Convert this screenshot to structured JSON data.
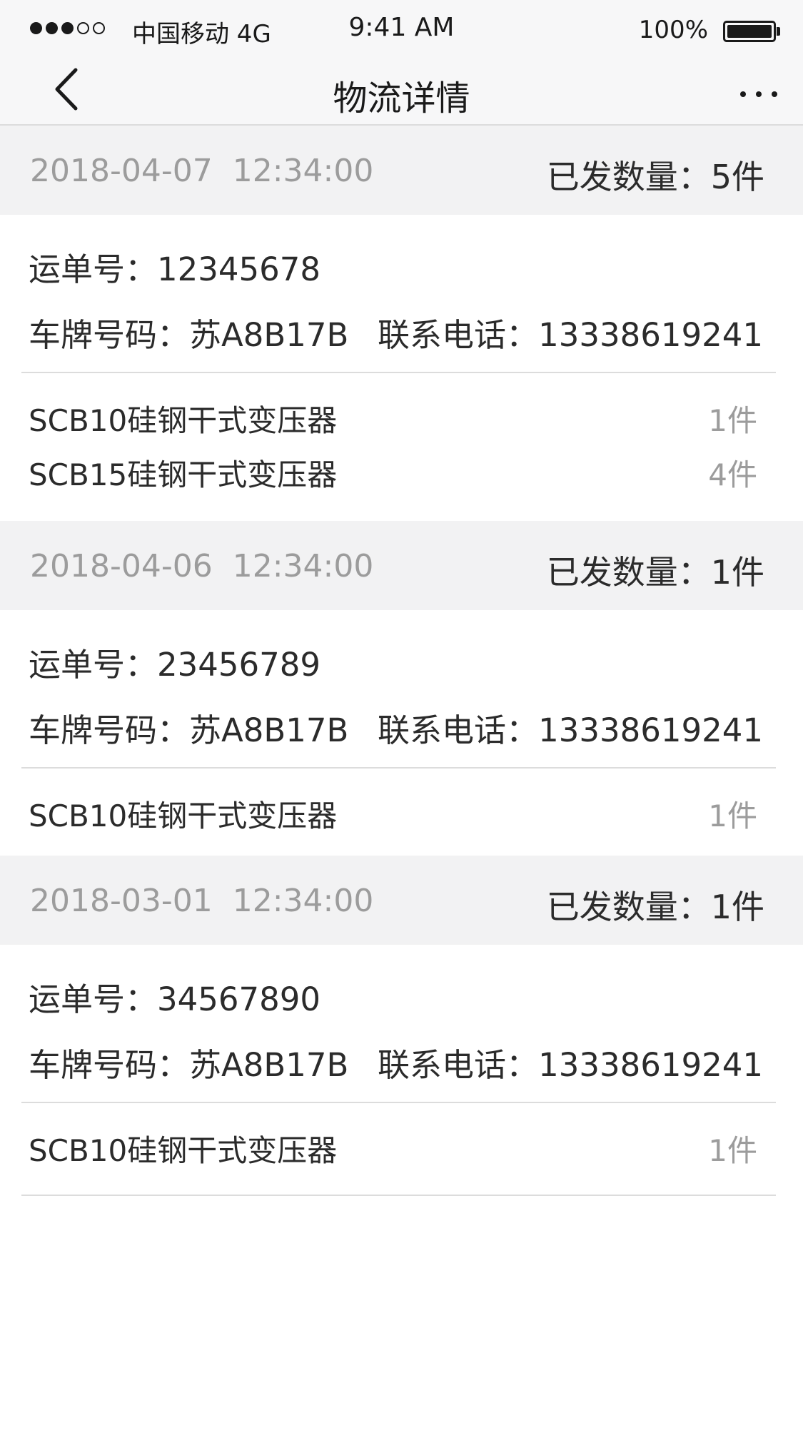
{
  "status_bar": {
    "carrier": "中国移动 4G",
    "time": "9:41 AM",
    "battery": "100%"
  },
  "nav": {
    "title": "物流详情"
  },
  "labels": {
    "waybill": "运单号：",
    "plate": "车牌号码：",
    "phone": "联系电话：",
    "shipped": "已发数量："
  },
  "records": [
    {
      "date": "2018-04-07",
      "time": "12:34:00",
      "shipped_count": "5件",
      "waybill_no": "12345678",
      "plate_no": "苏A8B17B",
      "phone": "13338619241",
      "items": [
        {
          "name": "SCB10硅钢干式变压器",
          "qty": "1件"
        },
        {
          "name": "SCB15硅钢干式变压器",
          "qty": "4件"
        }
      ]
    },
    {
      "date": "2018-04-06",
      "time": "12:34:00",
      "shipped_count": "1件",
      "waybill_no": "23456789",
      "plate_no": "苏A8B17B",
      "phone": "13338619241",
      "items": [
        {
          "name": "SCB10硅钢干式变压器",
          "qty": "1件"
        }
      ]
    },
    {
      "date": "2018-03-01",
      "time": "12:34:00",
      "shipped_count": "1件",
      "waybill_no": "34567890",
      "plate_no": "苏A8B17B",
      "phone": "13338619241",
      "items": [
        {
          "name": "SCB10硅钢干式变压器",
          "qty": "1件"
        }
      ]
    }
  ]
}
